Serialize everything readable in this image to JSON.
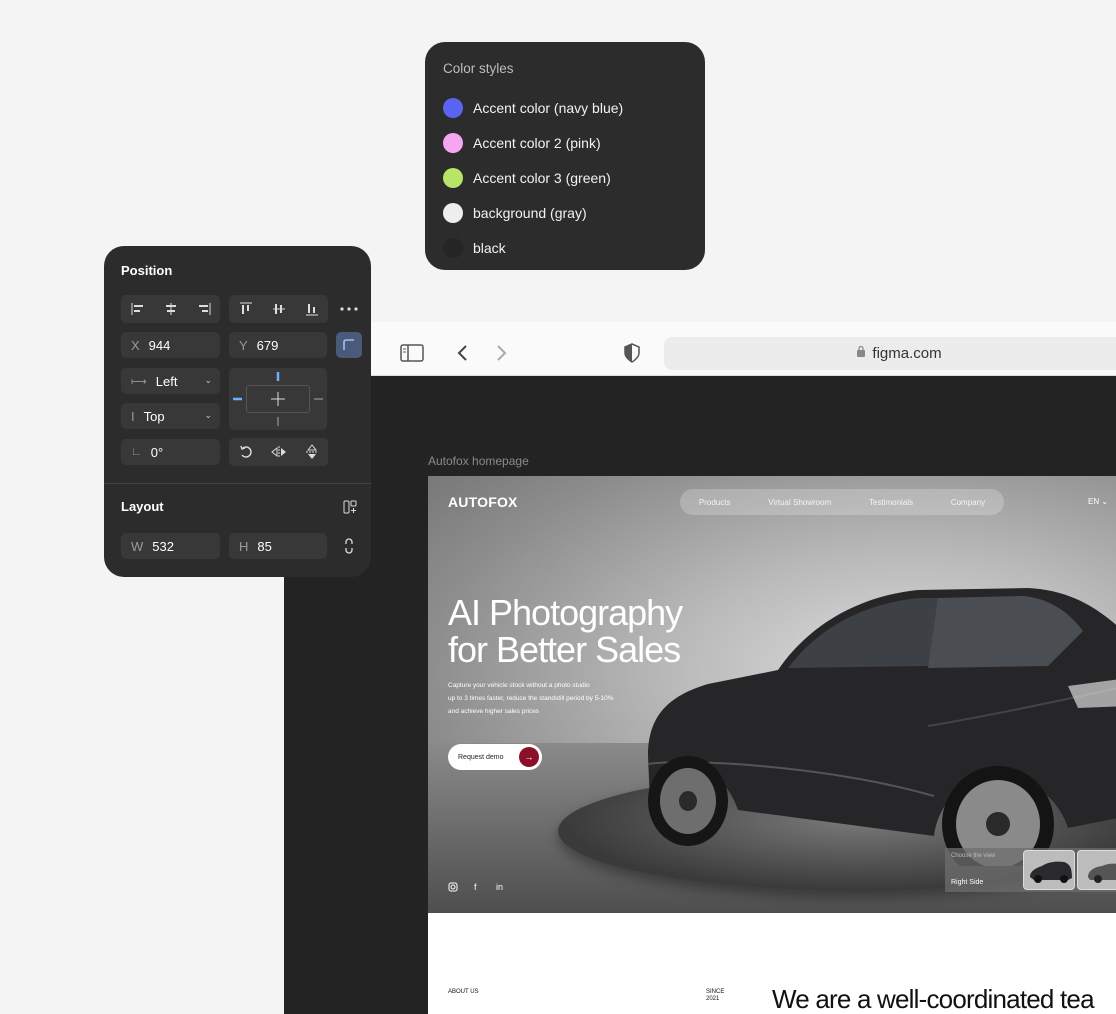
{
  "color_styles": {
    "title": "Color styles",
    "items": [
      {
        "label": "Accent color (navy blue)",
        "color": "#5a64f0"
      },
      {
        "label": "Accent color 2 (pink)",
        "color": "#f5a6f2"
      },
      {
        "label": "Accent color 3 (green)",
        "color": "#b8e467"
      },
      {
        "label": "background (gray)",
        "color": "#eeeeee"
      },
      {
        "label": "black",
        "color": "#252525"
      }
    ]
  },
  "position_panel": {
    "title": "Position",
    "x_key": "X",
    "x": "944",
    "y_key": "Y",
    "y": "679",
    "horizontal": "Left",
    "vertical": "Top",
    "rotation": "0°",
    "layout_title": "Layout",
    "w_key": "W",
    "w": "532",
    "h_key": "H",
    "h": "85"
  },
  "browser": {
    "url": "figma.com",
    "frame_label": "Autofox homepage"
  },
  "site": {
    "logo": "AUTOFOX",
    "nav": [
      "Products",
      "Virtual Showroom",
      "Testimonials",
      "Company"
    ],
    "lang": "EN",
    "headline_1": "AI Photography",
    "headline_2": "for Better Sales",
    "sub_1": "Capture your vehicle stock without a photo studio",
    "sub_2": "up to 3 times faster, reduce the standstill period by 5-10%",
    "sub_3": "and achieve higher sales prices",
    "demo_label": "Request demo",
    "view_caption": "Choose the view",
    "view_label": "Right Side",
    "about_label": "ABOUT US",
    "since_label": "SINCE",
    "since_year": "2021",
    "tagline": "We are a well-coordinated tea",
    "accent": "#8b0f28"
  }
}
